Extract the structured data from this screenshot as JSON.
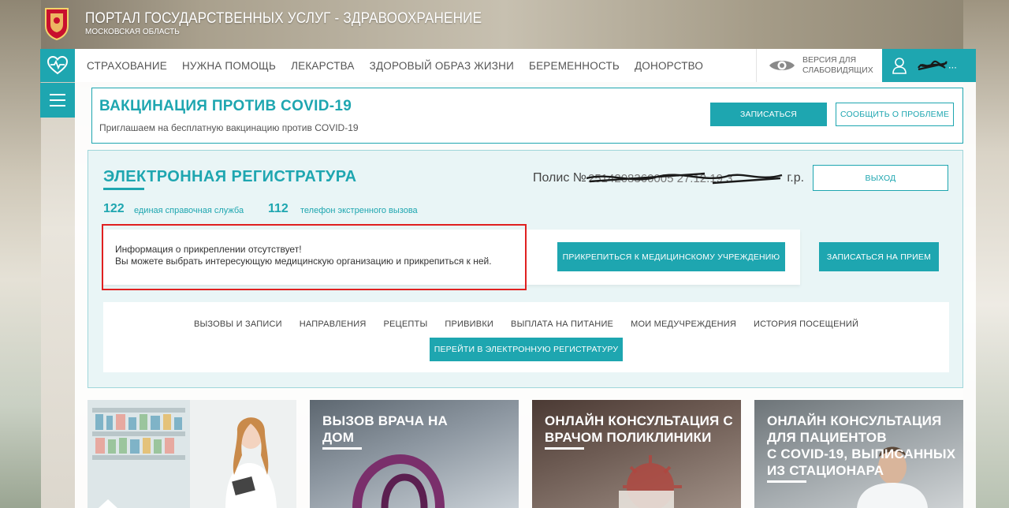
{
  "portal": {
    "title": "ПОРТАЛ ГОСУДАРСТВЕННЫХ УСЛУГ - ЗДРАВООХРАНЕНИЕ",
    "subtitle": "МОСКОВСКАЯ ОБЛАСТЬ"
  },
  "nav": {
    "items": [
      "СТРАХОВАНИЕ",
      "НУЖНА ПОМОЩЬ",
      "ЛЕКАРСТВА",
      "ЗДОРОВЫЙ ОБРАЗ ЖИЗНИ",
      "БЕРЕМЕННОСТЬ",
      "ДОНОРСТВО"
    ],
    "vision_line1": "ВЕРСИЯ ДЛЯ",
    "vision_line2": "СЛАБОВИДЯЩИХ",
    "user_suffix": "..."
  },
  "vaccine": {
    "title": "ВАКЦИНАЦИЯ ПРОТИВ COVID-19",
    "subtitle": "Приглашаем на бесплатную вакцинацию против COVID-19",
    "signup_button": "ЗАПИСАТЬСЯ",
    "report_button": "СООБЩИТЬ О ПРОБЛЕМЕ"
  },
  "registry": {
    "title": "ЭЛЕКТРОННАЯ РЕГИСТРАТУРА",
    "polis_prefix": "Полис №",
    "polis_suffix": "г.р.",
    "logout_button": "ВЫХОД",
    "phone1_number": "122",
    "phone1_label": "единая справочная служба",
    "phone2_number": "112",
    "phone2_label": "телефон экстренного вызова",
    "info_line1": "Информация о прикреплении отсутствует!",
    "info_line2": "Вы можете выбрать интересующую медицинскую организацию и прикрепиться к ней.",
    "attach_button": "ПРИКРЕПИТЬСЯ К МЕДИЦИНСКОМУ УЧРЕЖДЕНИЮ",
    "appointment_button": "ЗАПИСАТЬСЯ НА ПРИЕМ",
    "tabs": [
      "ВЫЗОВЫ И ЗАПИСИ",
      "НАПРАВЛЕНИЯ",
      "РЕЦЕПТЫ",
      "ПРИВИВКИ",
      "ВЫПЛАТА НА ПИТАНИЕ",
      "МОИ МЕДУЧРЕЖДЕНИЯ",
      "ИСТОРИЯ ПОСЕЩЕНИЙ"
    ],
    "goto_button": "ПЕРЕЙТИ В ЭЛЕКТРОННУЮ РЕГИСТРАТУРУ"
  },
  "cards": [
    {
      "title": ""
    },
    {
      "title_line1": "ВЫЗОВ ВРАЧА НА",
      "title_line2": "ДОМ"
    },
    {
      "title_line1": "ОНЛАЙН КОНСУЛЬТАЦИЯ С",
      "title_line2": "ВРАЧОМ ПОЛИКЛИНИКИ"
    },
    {
      "title_line1": "ОНЛАЙН КОНСУЛЬТАЦИЯ",
      "title_line2": "ДЛЯ ПАЦИЕНТОВ",
      "title_line3": "С COVID-19, ВЫПИСАННЫХ",
      "title_line4": "ИЗ СТАЦИОНАРА"
    }
  ],
  "colors": {
    "accent": "#1ea6b0",
    "alert_frame": "#e02020"
  }
}
